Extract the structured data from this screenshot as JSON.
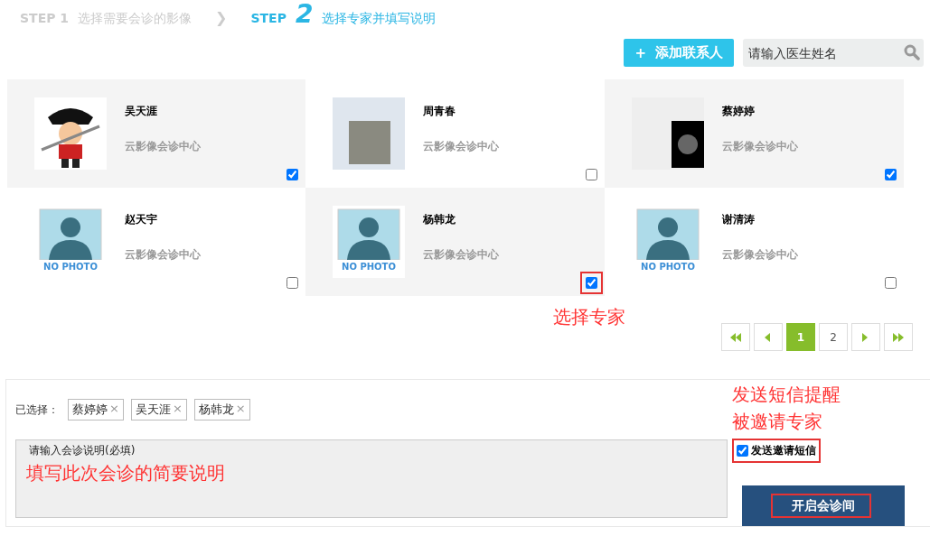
{
  "steps": [
    {
      "label": "STEP 1",
      "title": "选择需要会诊的影像",
      "selected": false
    },
    {
      "label": "STEP",
      "number": "2",
      "title": "选择专家并填写说明",
      "selected": true
    }
  ],
  "step_separator": "❯",
  "add_button": {
    "icon": "+",
    "label": "添加联系人"
  },
  "search": {
    "placeholder": "请输入医生姓名"
  },
  "experts": [
    {
      "name": "吴天涯",
      "org": "云影像会诊中心",
      "kind": "cartoon",
      "selected": true,
      "highlighted": false
    },
    {
      "name": "周青春",
      "org": "云影像会诊中心",
      "kind": "photo",
      "selected": false,
      "highlighted": false
    },
    {
      "name": "蔡婷婷",
      "org": "云影像会诊中心",
      "kind": "scan",
      "selected": true,
      "highlighted": false
    },
    {
      "name": "赵天宇",
      "org": "云影像会诊中心",
      "kind": "none",
      "photo_text": "NO PHOTO",
      "selected": false,
      "highlighted": false
    },
    {
      "name": "杨韩龙",
      "org": "云影像会诊中心",
      "kind": "none",
      "photo_text": "NO PHOTO",
      "selected": true,
      "highlighted": true
    },
    {
      "name": "谢清涛",
      "org": "云影像会诊中心",
      "kind": "none",
      "photo_text": "NO PHOTO",
      "selected": false,
      "highlighted": false
    }
  ],
  "annotation_select": "选择专家",
  "pagination": [
    {
      "kind": "first"
    },
    {
      "kind": "prev"
    },
    {
      "kind": "page",
      "label": "1",
      "selected": true
    },
    {
      "kind": "page",
      "label": "2",
      "selected": false
    },
    {
      "kind": "next"
    },
    {
      "kind": "last"
    }
  ],
  "selected_label": "已选择：",
  "selected_tags": [
    "蔡婷婷",
    "吴天涯",
    "杨韩龙"
  ],
  "tag_remove": "×",
  "description": {
    "placeholder": "请输入会诊说明(必填)",
    "annotation": "填写此次会诊的简要说明"
  },
  "sms_annotation": [
    "发送短信提醒",
    "被邀请专家"
  ],
  "sms": {
    "label": "发送邀请短信",
    "checked": true,
    "highlighted": true
  },
  "start_button": {
    "label": "开启会诊间",
    "highlighted": true
  }
}
